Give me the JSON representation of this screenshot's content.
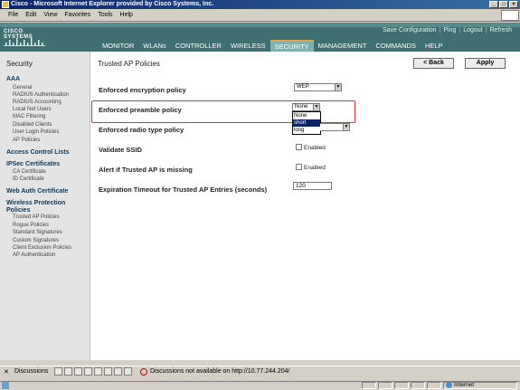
{
  "window": {
    "title": "Cisco - Microsoft Internet Explorer provided by Cisco Systems, Inc."
  },
  "menubar": [
    "File",
    "Edit",
    "View",
    "Favorites",
    "Tools",
    "Help"
  ],
  "header": {
    "logo_text": "CISCO SYSTEMS",
    "links": [
      "Save Configuration",
      "Ping",
      "Logout",
      "Refresh"
    ],
    "tabs": [
      "MONITOR",
      "WLANs",
      "CONTROLLER",
      "WIRELESS",
      "SECURITY",
      "MANAGEMENT",
      "COMMANDS",
      "HELP"
    ],
    "active_tab": "SECURITY"
  },
  "sidebar": {
    "title": "Security",
    "sections": [
      {
        "head": "AAA",
        "items": [
          "General",
          "RADIUS Authentication",
          "RADIUS Accounting",
          "Local Net Users",
          "MAC Filtering",
          "Disabled Clients",
          "User Login Policies",
          "AP Policies"
        ]
      },
      {
        "head": "Access Control Lists",
        "items": []
      },
      {
        "head": "IPSec Certificates",
        "items": [
          "CA Certificate",
          "ID Certificate"
        ]
      },
      {
        "head": "Web Auth Certificate",
        "items": []
      },
      {
        "head": "Wireless Protection Policies",
        "items": [
          "Trusted AP Policies",
          "Rogue Policies",
          "Standard Signatures",
          "Custom Signatures",
          "Client Exclusion Policies",
          "AP Authentication"
        ]
      }
    ]
  },
  "main": {
    "page_title": "Trusted AP Policies",
    "back_label": "< Back",
    "apply_label": "Apply",
    "rows": {
      "encryption": {
        "label": "Enforced encryption policy",
        "value": "WEP"
      },
      "preamble": {
        "label": "Enforced preamble policy",
        "value": "None",
        "options": [
          "None",
          "short",
          "long"
        ],
        "highlighted": "short"
      },
      "radio": {
        "label": "Enforced radio type policy"
      },
      "ssid": {
        "label": "Validate SSID",
        "check_label": "Enabled",
        "checked": false
      },
      "alert": {
        "label": "Alert if Trusted AP is missing",
        "check_label": "Enabled",
        "checked": false
      },
      "timeout": {
        "label": "Expiration Timeout for Trusted AP Entries (seconds)",
        "value": "120"
      }
    }
  },
  "discussions": {
    "label": "Discussions",
    "status": "Discussions not available on http://10.77.244.204/"
  },
  "statusbar": {
    "zone": "Internet"
  }
}
